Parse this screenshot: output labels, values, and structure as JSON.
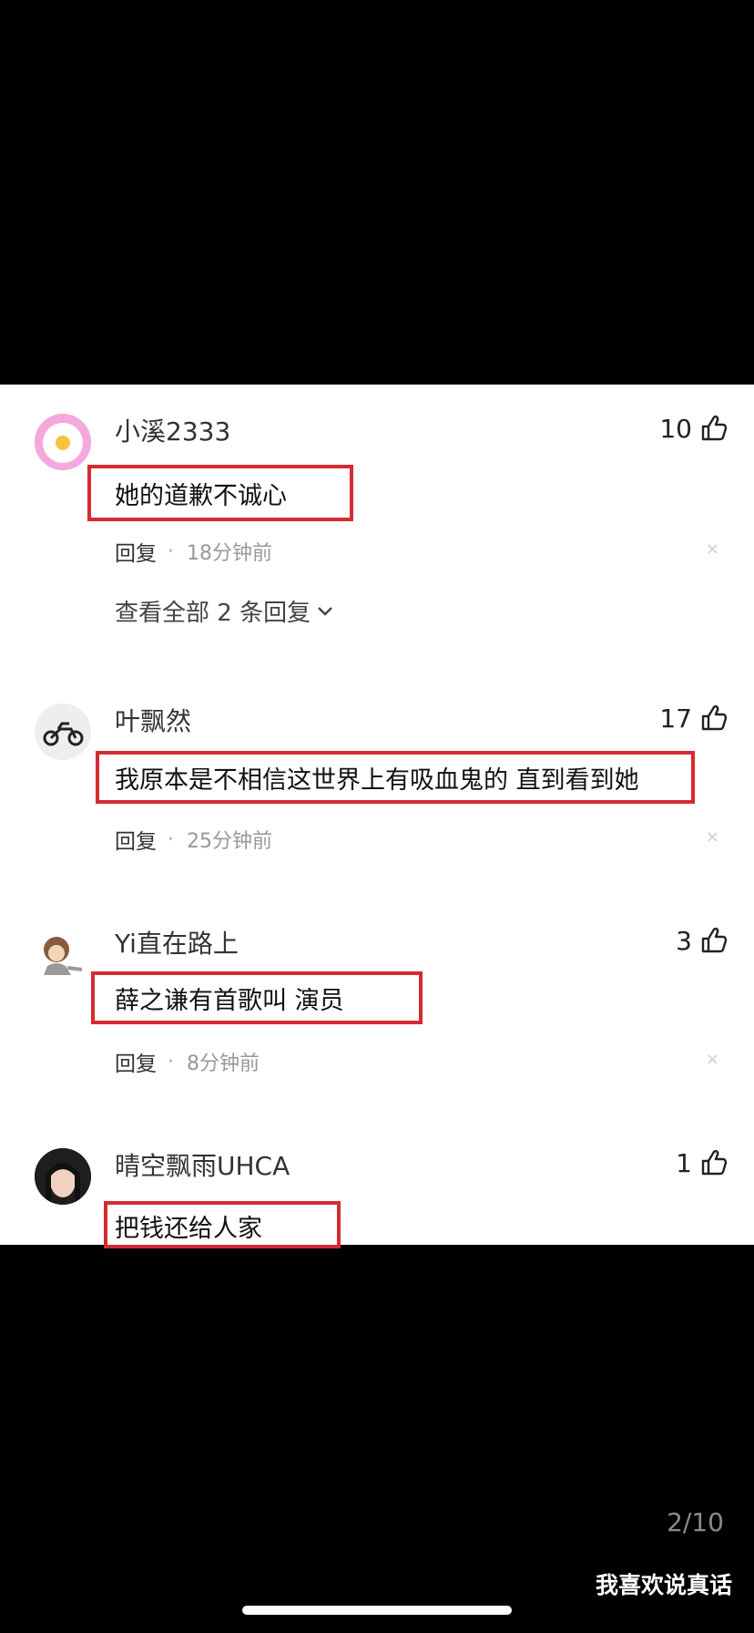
{
  "comments": [
    {
      "user": "小溪2333",
      "likes": "10",
      "text": "她的道歉不诚心",
      "reply": "回复",
      "time": "18分钟前",
      "expand": "查看全部 2 条回复"
    },
    {
      "user": "叶飘然",
      "likes": "17",
      "text": "我原本是不相信这世界上有吸血鬼的 直到看到她",
      "reply": "回复",
      "time": "25分钟前"
    },
    {
      "user": "Yi直在路上",
      "likes": "3",
      "text": "薛之谦有首歌叫 演员",
      "reply": "回复",
      "time": "8分钟前"
    },
    {
      "user": "晴空飘雨UHCA",
      "likes": "1",
      "text": "把钱还给人家"
    }
  ],
  "dot": "·",
  "close_glyph": "×",
  "page_counter": "2/10",
  "watermark": "我喜欢说真话",
  "colors": {
    "highlight": "#d62a32",
    "background": "#000000",
    "panel": "#ffffff"
  }
}
